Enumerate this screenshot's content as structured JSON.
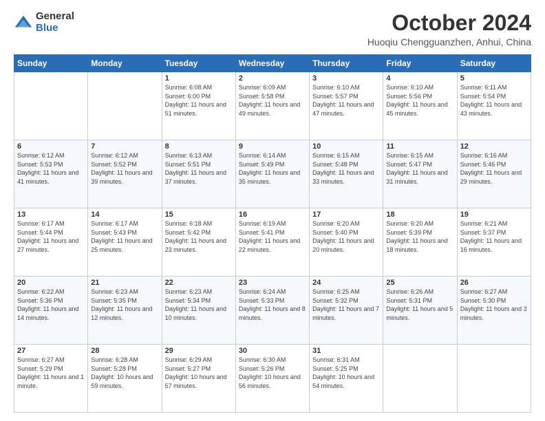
{
  "logo": {
    "general": "General",
    "blue": "Blue"
  },
  "header": {
    "month": "October 2024",
    "location": "Huoqiu Chengguanzhen, Anhui, China"
  },
  "days_of_week": [
    "Sunday",
    "Monday",
    "Tuesday",
    "Wednesday",
    "Thursday",
    "Friday",
    "Saturday"
  ],
  "weeks": [
    [
      {
        "day": "",
        "sunrise": "",
        "sunset": "",
        "daylight": ""
      },
      {
        "day": "",
        "sunrise": "",
        "sunset": "",
        "daylight": ""
      },
      {
        "day": "1",
        "sunrise": "Sunrise: 6:08 AM",
        "sunset": "Sunset: 6:00 PM",
        "daylight": "Daylight: 11 hours and 51 minutes."
      },
      {
        "day": "2",
        "sunrise": "Sunrise: 6:09 AM",
        "sunset": "Sunset: 5:58 PM",
        "daylight": "Daylight: 11 hours and 49 minutes."
      },
      {
        "day": "3",
        "sunrise": "Sunrise: 6:10 AM",
        "sunset": "Sunset: 5:57 PM",
        "daylight": "Daylight: 11 hours and 47 minutes."
      },
      {
        "day": "4",
        "sunrise": "Sunrise: 6:10 AM",
        "sunset": "Sunset: 5:56 PM",
        "daylight": "Daylight: 11 hours and 45 minutes."
      },
      {
        "day": "5",
        "sunrise": "Sunrise: 6:11 AM",
        "sunset": "Sunset: 5:54 PM",
        "daylight": "Daylight: 11 hours and 43 minutes."
      }
    ],
    [
      {
        "day": "6",
        "sunrise": "Sunrise: 6:12 AM",
        "sunset": "Sunset: 5:53 PM",
        "daylight": "Daylight: 11 hours and 41 minutes."
      },
      {
        "day": "7",
        "sunrise": "Sunrise: 6:12 AM",
        "sunset": "Sunset: 5:52 PM",
        "daylight": "Daylight: 11 hours and 39 minutes."
      },
      {
        "day": "8",
        "sunrise": "Sunrise: 6:13 AM",
        "sunset": "Sunset: 5:51 PM",
        "daylight": "Daylight: 11 hours and 37 minutes."
      },
      {
        "day": "9",
        "sunrise": "Sunrise: 6:14 AM",
        "sunset": "Sunset: 5:49 PM",
        "daylight": "Daylight: 11 hours and 35 minutes."
      },
      {
        "day": "10",
        "sunrise": "Sunrise: 6:15 AM",
        "sunset": "Sunset: 5:48 PM",
        "daylight": "Daylight: 11 hours and 33 minutes."
      },
      {
        "day": "11",
        "sunrise": "Sunrise: 6:15 AM",
        "sunset": "Sunset: 5:47 PM",
        "daylight": "Daylight: 11 hours and 31 minutes."
      },
      {
        "day": "12",
        "sunrise": "Sunrise: 6:16 AM",
        "sunset": "Sunset: 5:46 PM",
        "daylight": "Daylight: 11 hours and 29 minutes."
      }
    ],
    [
      {
        "day": "13",
        "sunrise": "Sunrise: 6:17 AM",
        "sunset": "Sunset: 5:44 PM",
        "daylight": "Daylight: 11 hours and 27 minutes."
      },
      {
        "day": "14",
        "sunrise": "Sunrise: 6:17 AM",
        "sunset": "Sunset: 5:43 PM",
        "daylight": "Daylight: 11 hours and 25 minutes."
      },
      {
        "day": "15",
        "sunrise": "Sunrise: 6:18 AM",
        "sunset": "Sunset: 5:42 PM",
        "daylight": "Daylight: 11 hours and 23 minutes."
      },
      {
        "day": "16",
        "sunrise": "Sunrise: 6:19 AM",
        "sunset": "Sunset: 5:41 PM",
        "daylight": "Daylight: 11 hours and 22 minutes."
      },
      {
        "day": "17",
        "sunrise": "Sunrise: 6:20 AM",
        "sunset": "Sunset: 5:40 PM",
        "daylight": "Daylight: 11 hours and 20 minutes."
      },
      {
        "day": "18",
        "sunrise": "Sunrise: 6:20 AM",
        "sunset": "Sunset: 5:39 PM",
        "daylight": "Daylight: 11 hours and 18 minutes."
      },
      {
        "day": "19",
        "sunrise": "Sunrise: 6:21 AM",
        "sunset": "Sunset: 5:37 PM",
        "daylight": "Daylight: 11 hours and 16 minutes."
      }
    ],
    [
      {
        "day": "20",
        "sunrise": "Sunrise: 6:22 AM",
        "sunset": "Sunset: 5:36 PM",
        "daylight": "Daylight: 11 hours and 14 minutes."
      },
      {
        "day": "21",
        "sunrise": "Sunrise: 6:23 AM",
        "sunset": "Sunset: 5:35 PM",
        "daylight": "Daylight: 11 hours and 12 minutes."
      },
      {
        "day": "22",
        "sunrise": "Sunrise: 6:23 AM",
        "sunset": "Sunset: 5:34 PM",
        "daylight": "Daylight: 11 hours and 10 minutes."
      },
      {
        "day": "23",
        "sunrise": "Sunrise: 6:24 AM",
        "sunset": "Sunset: 5:33 PM",
        "daylight": "Daylight: 11 hours and 8 minutes."
      },
      {
        "day": "24",
        "sunrise": "Sunrise: 6:25 AM",
        "sunset": "Sunset: 5:32 PM",
        "daylight": "Daylight: 11 hours and 7 minutes."
      },
      {
        "day": "25",
        "sunrise": "Sunrise: 6:26 AM",
        "sunset": "Sunset: 5:31 PM",
        "daylight": "Daylight: 11 hours and 5 minutes."
      },
      {
        "day": "26",
        "sunrise": "Sunrise: 6:27 AM",
        "sunset": "Sunset: 5:30 PM",
        "daylight": "Daylight: 11 hours and 3 minutes."
      }
    ],
    [
      {
        "day": "27",
        "sunrise": "Sunrise: 6:27 AM",
        "sunset": "Sunset: 5:29 PM",
        "daylight": "Daylight: 11 hours and 1 minute."
      },
      {
        "day": "28",
        "sunrise": "Sunrise: 6:28 AM",
        "sunset": "Sunset: 5:28 PM",
        "daylight": "Daylight: 10 hours and 59 minutes."
      },
      {
        "day": "29",
        "sunrise": "Sunrise: 6:29 AM",
        "sunset": "Sunset: 5:27 PM",
        "daylight": "Daylight: 10 hours and 57 minutes."
      },
      {
        "day": "30",
        "sunrise": "Sunrise: 6:30 AM",
        "sunset": "Sunset: 5:26 PM",
        "daylight": "Daylight: 10 hours and 56 minutes."
      },
      {
        "day": "31",
        "sunrise": "Sunrise: 6:31 AM",
        "sunset": "Sunset: 5:25 PM",
        "daylight": "Daylight: 10 hours and 54 minutes."
      },
      {
        "day": "",
        "sunrise": "",
        "sunset": "",
        "daylight": ""
      },
      {
        "day": "",
        "sunrise": "",
        "sunset": "",
        "daylight": ""
      }
    ]
  ]
}
